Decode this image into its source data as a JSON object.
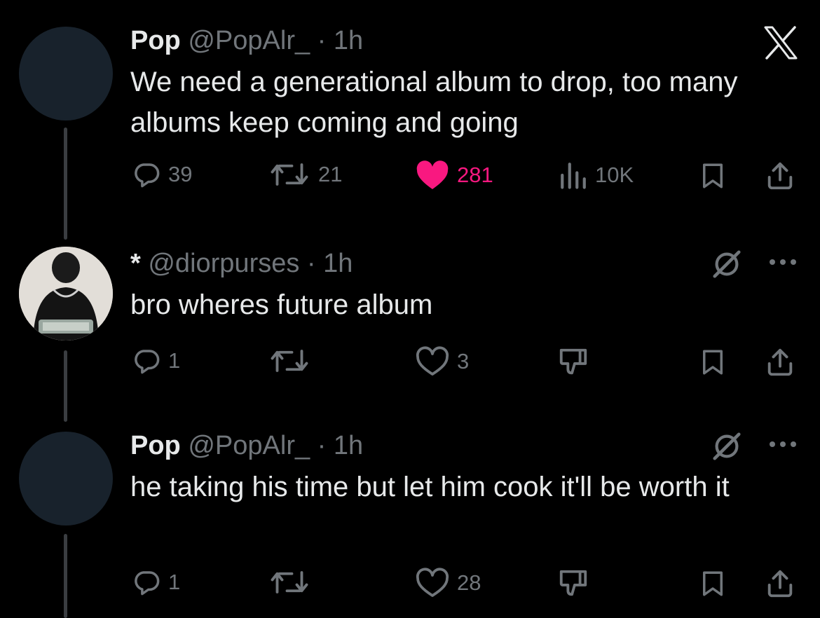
{
  "tweets": [
    {
      "name": "Pop",
      "handle": "@PopAlr_",
      "dot": "·",
      "time": "1h",
      "text": "We need a generational album to drop, too many albums keep coming and going",
      "replies": "39",
      "reposts": "21",
      "likes": "281",
      "views": "10K",
      "liked": true
    },
    {
      "name": "*",
      "handle": "@diorpurses",
      "dot": "·",
      "time": "1h",
      "text": "bro wheres future album",
      "replies": "1",
      "reposts": "",
      "likes": "3"
    },
    {
      "name": "Pop",
      "handle": "@PopAlr_",
      "dot": "·",
      "time": "1h",
      "text": "he taking his time but let him cook it'll be worth it",
      "replies": "1",
      "reposts": "",
      "likes": "28"
    }
  ],
  "icons": {
    "logo": "x-logo-icon",
    "reply": "reply-bubble-icon",
    "repost": "repost-icon",
    "like": "heart-icon",
    "views": "views-chart-icon",
    "bookmark": "bookmark-icon",
    "share": "share-icon",
    "grok": "grok-slash-icon",
    "more": "more-dots-icon",
    "downvote": "downvote-icon"
  },
  "colors": {
    "background": "#000000",
    "text": "#e7e9ea",
    "muted": "#71767b",
    "like": "#f91880",
    "avatar": "#18222c",
    "threadLine": "#3a3d41"
  }
}
